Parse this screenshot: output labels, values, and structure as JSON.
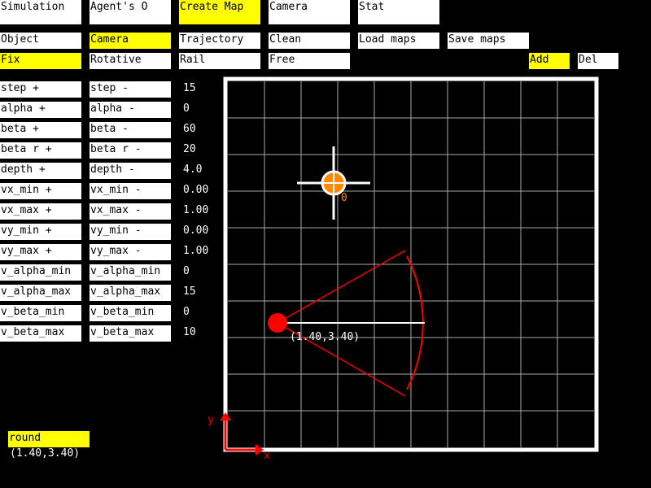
{
  "top_tabs": [
    {
      "label": "Simulation",
      "active": false
    },
    {
      "label": "Agent's O",
      "active": false
    },
    {
      "label": "Create Map",
      "active": true
    },
    {
      "label": "Camera",
      "active": false
    },
    {
      "label": "Stat",
      "active": false
    }
  ],
  "row2": [
    {
      "label": "Object",
      "active": false
    },
    {
      "label": "Camera",
      "active": true
    },
    {
      "label": "Trajectory",
      "active": false
    },
    {
      "label": "Clean",
      "active": false
    },
    {
      "label": "Load maps",
      "active": false
    },
    {
      "label": "Save maps",
      "active": false
    }
  ],
  "row3": [
    {
      "label": "Fix",
      "active": true
    },
    {
      "label": "Rotative",
      "active": false
    },
    {
      "label": "Rail",
      "active": false
    },
    {
      "label": "Free",
      "active": false
    }
  ],
  "add_label": "Add",
  "del_label": "Del",
  "params": [
    {
      "plus": "step +",
      "minus": "step -",
      "value": "15"
    },
    {
      "plus": "alpha +",
      "minus": "alpha -",
      "value": "0"
    },
    {
      "plus": "beta +",
      "minus": "beta -",
      "value": "60"
    },
    {
      "plus": "beta r +",
      "minus": "beta r -",
      "value": "20"
    },
    {
      "plus": "depth +",
      "minus": "depth -",
      "value": "4.0"
    },
    {
      "plus": "vx_min +",
      "minus": "vx_min -",
      "value": "0.00"
    },
    {
      "plus": "vx_max +",
      "minus": "vx_max -",
      "value": "1.00"
    },
    {
      "plus": "vy_min +",
      "minus": "vy_min -",
      "value": "0.00"
    },
    {
      "plus": "vy_max +",
      "minus": "vy_max -",
      "value": "1.00"
    },
    {
      "plus": "v_alpha_min",
      "minus": "v_alpha_min",
      "value": "0"
    },
    {
      "plus": "v_alpha_max",
      "minus": "v_alpha_max",
      "value": "15"
    },
    {
      "plus": "v_beta_min",
      "minus": "v_beta_min",
      "value": "0"
    },
    {
      "plus": "v_beta_max",
      "minus": "v_beta_max",
      "value": "10"
    }
  ],
  "map": {
    "object_label": "0",
    "camera_label": "(1.40,3.40)",
    "axis_x": "x",
    "axis_y": "y",
    "colors": {
      "grid": "#aaaaaa",
      "border": "#ffffff",
      "camera": "#ff0000",
      "object": "#ff8800"
    }
  },
  "status": {
    "mode": "round",
    "coords": "(1.40,3.40)"
  }
}
